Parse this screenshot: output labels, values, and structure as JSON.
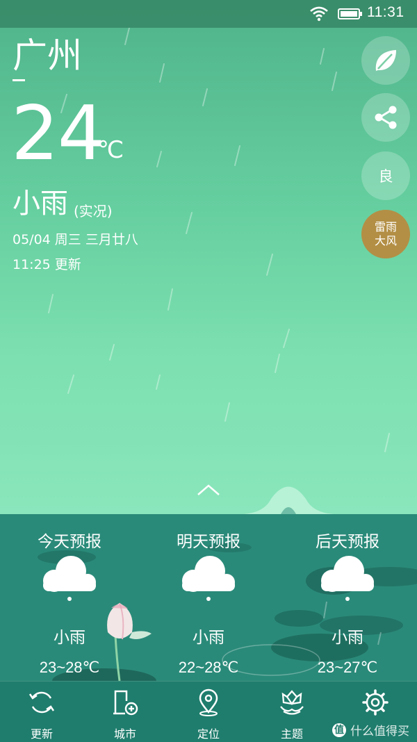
{
  "status_bar": {
    "time": "11:31"
  },
  "location": {
    "city": "广州"
  },
  "current": {
    "temperature": "24",
    "unit": "℃",
    "condition": "小雨",
    "condition_note": "(实况)",
    "date": "05/04 周三 三月廿八",
    "updated": "11:25 更新"
  },
  "side_buttons": {
    "air_quality": "良",
    "alert_line1": "雷雨",
    "alert_line2": "大风",
    "alert_color": "#b38f45"
  },
  "forecast": [
    {
      "title": "今天预报",
      "condition": "小雨",
      "range": "23~28℃",
      "icon": "rain-cloud-icon"
    },
    {
      "title": "明天预报",
      "condition": "小雨",
      "range": "22~28℃",
      "icon": "rain-cloud-icon"
    },
    {
      "title": "后天预报",
      "condition": "小雨",
      "range": "23~27℃",
      "icon": "rain-cloud-icon"
    }
  ],
  "nav": [
    {
      "label": "更新",
      "icon": "refresh-icon"
    },
    {
      "label": "城市",
      "icon": "add-city-icon"
    },
    {
      "label": "定位",
      "icon": "location-pin-icon"
    },
    {
      "label": "主题",
      "icon": "lotus-theme-icon"
    },
    {
      "label": "",
      "icon": "settings-gear-icon"
    }
  ],
  "watermark": {
    "badge": "值",
    "text": "什么值得买"
  },
  "colors": {
    "sky_top": "#4fb38a",
    "sky_bottom": "#8ae6bc",
    "pond": "#2a8a79",
    "nav_bg": "#1f7d6d"
  }
}
